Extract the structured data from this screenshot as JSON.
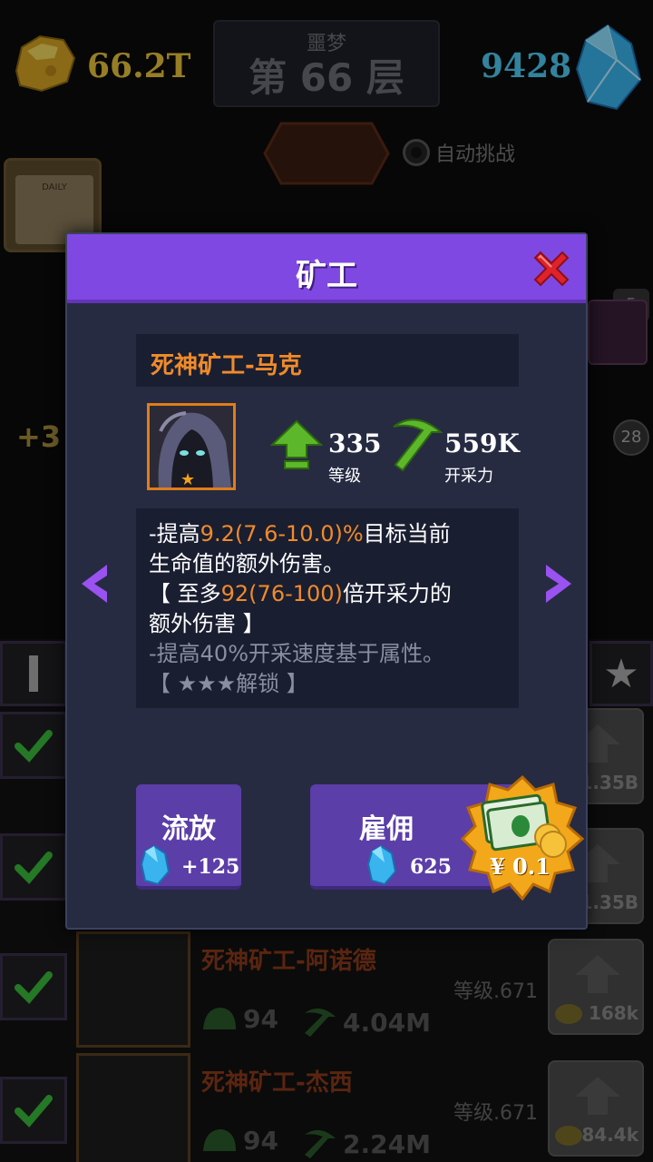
{
  "hud": {
    "gold_amount": "66.2T",
    "floor_mode": "噩梦",
    "floor_label": "第 66 层",
    "gem_amount": "9428",
    "auto_challenge_label": "自动挑战"
  },
  "background": {
    "calendar_label": "DAILY",
    "side_plus_text": "+3",
    "side_badge_number": "28",
    "chest_badge_number": "5",
    "upgrade_prices": [
      "1.35B",
      "1.35B",
      "168k",
      "84.4k"
    ],
    "miners": [
      {
        "name": "死神矿工-阿诺德",
        "level_text": "等级.671",
        "helmet_value": "94",
        "mining_value": "4.04M"
      },
      {
        "name": "死神矿工-杰西",
        "level_text": "等级.671",
        "helmet_value": "94",
        "mining_value": "2.24M"
      }
    ]
  },
  "modal": {
    "title": "矿工",
    "miner_name": "死神矿工-马克",
    "level_value": "335",
    "level_label": "等级",
    "mining_power_value": "559K",
    "mining_power_label": "开采力",
    "description": {
      "line1_pre": "-提高",
      "line1_hl": "9.2(7.6-10.0)%",
      "line1_post": "目标当前",
      "line2": "生命值的额外伤害。",
      "line3_pre": "【 至多",
      "line3_hl": "92(76-100)",
      "line3_post": "倍开采力的",
      "line4": "额外伤害 】",
      "line5": "-提高40%开采速度基于属性。",
      "line6": "【 ★★★解锁 】"
    },
    "exile_button": {
      "label": "流放",
      "gem_reward": "+125"
    },
    "hire_button": {
      "label": "雇佣",
      "gem_cost": "625"
    },
    "money_offer": {
      "price": "¥ 0.1"
    }
  },
  "colors": {
    "modal_header": "#8048e2",
    "modal_body": "#262b42",
    "highlight_orange": "#f08b2a",
    "gem_blue": "#4ec9f2",
    "gold": "#e8c23a",
    "button_purple": "#5b3ea8"
  },
  "icons": {
    "gold": "gold-nugget-icon",
    "gem": "blue-crystal-icon",
    "close": "red-x-close-icon",
    "level": "green-up-arrow-icon",
    "mining": "green-pickaxe-icon",
    "nav_prev": "purple-chevron-left-icon",
    "nav_next": "purple-chevron-right-icon",
    "money": "cash-stack-badge-icon",
    "check": "green-check-icon",
    "star": "star-icon"
  }
}
